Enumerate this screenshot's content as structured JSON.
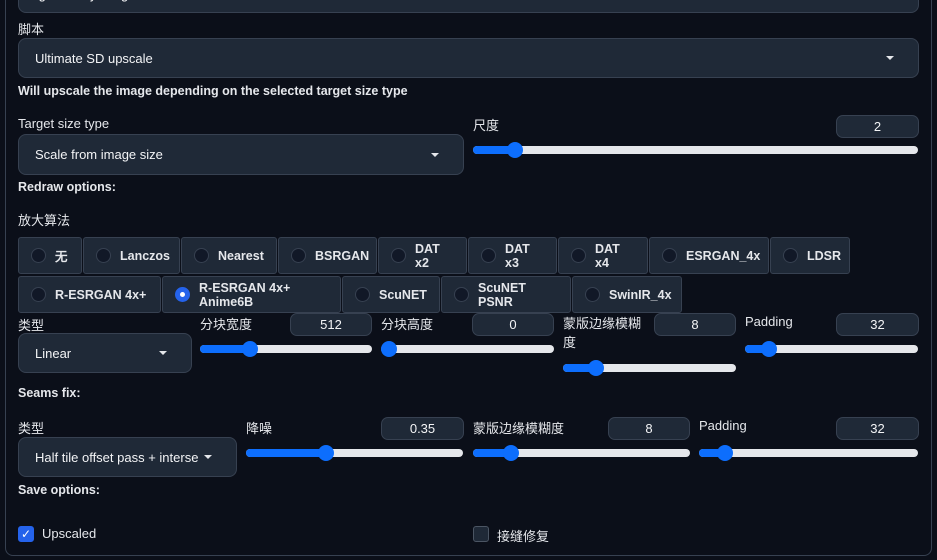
{
  "top_input": {
    "value": "Ignore any image"
  },
  "script": {
    "label": "脚本",
    "value": "Ultimate SD upscale",
    "info": "Will upscale the image depending on the selected target size type"
  },
  "target": {
    "label": "Target size type",
    "value": "Scale from image size"
  },
  "scale": {
    "label": "尺度",
    "value": "2",
    "fill": 0.08
  },
  "redraw": {
    "label": "Redraw options:",
    "upscaler_label": "放大算法",
    "upscalers": [
      "无",
      "Lanczos",
      "Nearest",
      "BSRGAN",
      "DAT x2",
      "DAT x3",
      "DAT x4",
      "ESRGAN_4x",
      "LDSR",
      "R-ESRGAN 4x+",
      "R-ESRGAN 4x+ Anime6B",
      "ScuNET",
      "ScuNET PSNR",
      "SwinIR_4x"
    ],
    "selected": "R-ESRGAN 4x+ Anime6B",
    "type_label": "类型",
    "type_value": "Linear",
    "tile_width": {
      "label": "分块宽度",
      "value": "512",
      "fill": 0.27
    },
    "tile_height": {
      "label": "分块高度",
      "value": "0",
      "fill": 0.0
    },
    "mask_blur": {
      "label": "蒙版边缘模糊度",
      "value": "8",
      "fill": 0.16
    },
    "padding": {
      "label": "Padding",
      "value": "32",
      "fill": 0.1
    }
  },
  "seams": {
    "label": "Seams fix:",
    "type_label": "类型",
    "type_value": "Half tile offset pass + interse",
    "denoise": {
      "label": "降噪",
      "value": "0.35",
      "fill": 0.36
    },
    "mask_blur": {
      "label": "蒙版边缘模糊度",
      "value": "8",
      "fill": 0.15
    },
    "padding": {
      "label": "Padding",
      "value": "32",
      "fill": 0.09
    }
  },
  "save": {
    "label": "Save options:",
    "upscaled": {
      "label": "Upscaled",
      "checked": true
    },
    "seams_fix": {
      "label": "接缝修复",
      "checked": false
    }
  },
  "colors": {
    "accent": "#0d6efd",
    "background": "#0b0f19",
    "panel": "#1f2937"
  }
}
